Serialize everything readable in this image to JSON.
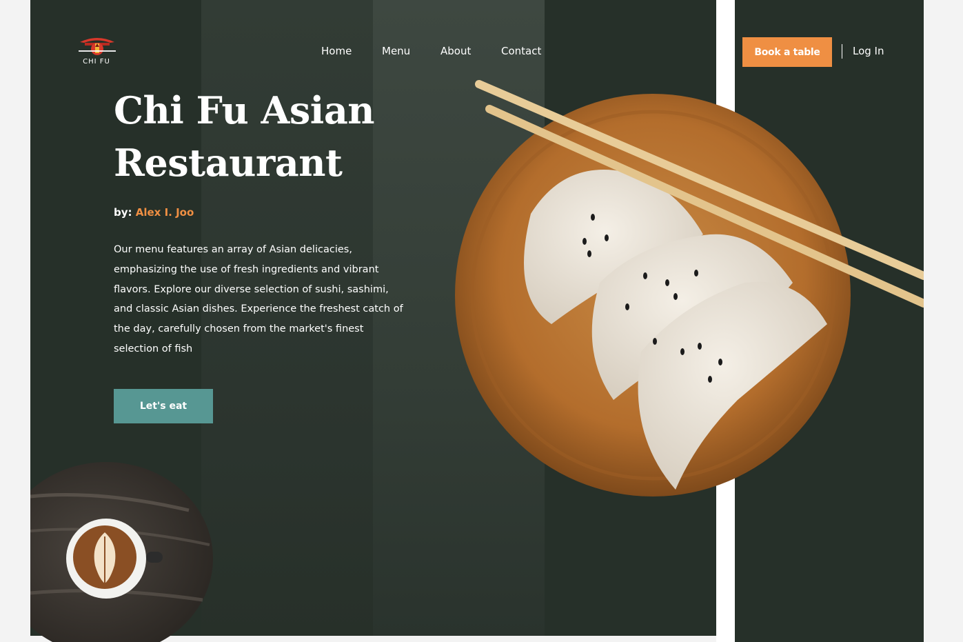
{
  "brand": {
    "logo_text": "CHI FU"
  },
  "nav": {
    "items": [
      {
        "label": "Home"
      },
      {
        "label": "Menu"
      },
      {
        "label": "About"
      },
      {
        "label": "Contact"
      }
    ],
    "book_label": "Book a table",
    "login_label": "Log In"
  },
  "hero": {
    "title": "Chi Fu Asian Restaurant",
    "by_label": "by:",
    "author": "Alex I. Joo",
    "description": "Our menu features an array of Asian delicacies, emphasizing the use of fresh ingredients and vibrant flavors. Explore our diverse selection of sushi, sashimi, and classic Asian dishes. Experience the freshest catch of the day, carefully chosen from the market's finest selection of fish",
    "cta_label": "Let's eat"
  },
  "colors": {
    "background_dark": "#263029",
    "accent_orange": "#ef8f43",
    "accent_teal": "#579793",
    "logo_red": "#d8382b"
  },
  "icons": {
    "logo": "chi-fu-logo-icon"
  }
}
